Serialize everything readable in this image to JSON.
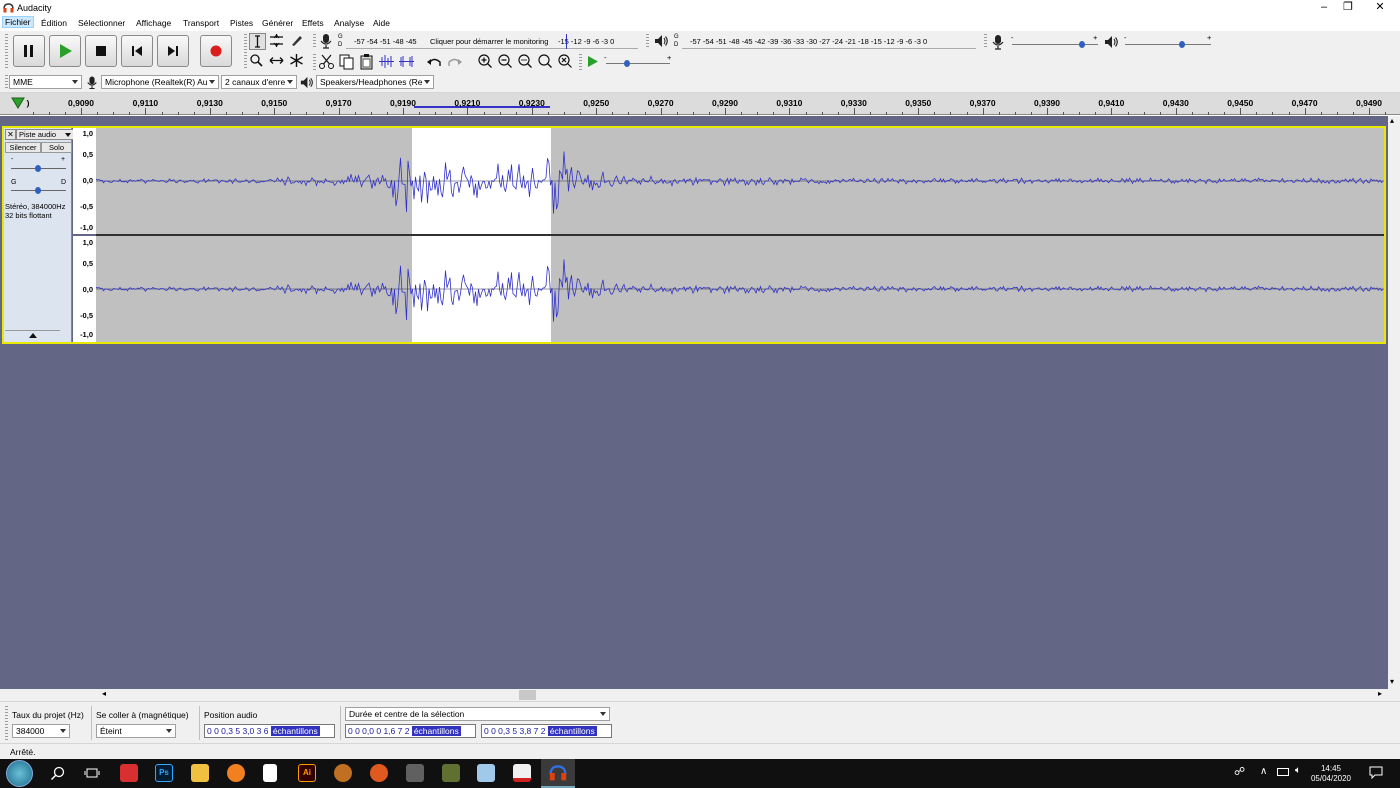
{
  "window": {
    "title": "Audacity"
  },
  "menu": [
    "Fichier",
    "Édition",
    "Sélectionner",
    "Affichage",
    "Transport",
    "Pistes",
    "Générer",
    "Effets",
    "Analyse",
    "Aide"
  ],
  "meters": {
    "record_channel_l": "G",
    "record_channel_r": "D",
    "record_scale": "-57 -54 -51 -48 -45",
    "record_hint": "Cliquer pour démarrer le monitoring",
    "record_scale2": "-15 -12 -9 -6 -3 0",
    "play_scale": "-57 -54 -51 -48 -45 -42 -39 -36 -33 -30 -27 -24 -21 -18 -15 -12 -9 -6 -3 0",
    "play_channel_l": "G",
    "play_channel_r": "D",
    "minus": "-",
    "plus": "+"
  },
  "device": {
    "host": "MME",
    "input": "Microphone (Realtek(R) Au",
    "channels": "2 canaux d'enre",
    "output": "Speakers/Headphones (Re"
  },
  "ruler": {
    "first_partial": ")",
    "labels": [
      "0,9090",
      "0,9110",
      "0,9130",
      "0,9150",
      "0,9170",
      "0,9190",
      "0,9210",
      "0,9230",
      "0,9250",
      "0,9270",
      "0,9290",
      "0,9310",
      "0,9330",
      "0,9350",
      "0,9370",
      "0,9390",
      "0,9410",
      "0,9430",
      "0,9450",
      "0,9470",
      "0,9490"
    ]
  },
  "track": {
    "name": "Piste audio",
    "mute": "Silencer",
    "solo": "Solo",
    "gain_minus": "-",
    "gain_plus": "+",
    "pan_left": "G",
    "pan_right": "D",
    "info_line1": "Stéréo, 384000Hz",
    "info_line2": "32 bits flottant",
    "scale": [
      "1,0",
      "0,5",
      "0,0",
      "-0,5",
      "-1,0"
    ],
    "selection_fraction": {
      "start": 0.245,
      "end": 0.353
    }
  },
  "selection_toolbar": {
    "rate_label": "Taux du projet (Hz)",
    "rate_value": "384000",
    "snap_label": "Se coller à (magnétique)",
    "snap_value": "Éteint",
    "position_label": "Position audio",
    "position_value": "0 0 0,3 5 3,0 3 6",
    "selection_mode": "Durée et centre de la sélection",
    "duration_value": "0 0 0,0 0 1,6 7 2",
    "center_value": "0 0 0,3 5 3,8 7 2",
    "unit": "échantillons"
  },
  "status": {
    "text": "Arrêté."
  },
  "taskbar": {
    "time": "14:45",
    "date": "05/04/2020"
  },
  "colors": {
    "waveform": "#3232c8",
    "background": "#636685",
    "selection": "#ffffff",
    "unselected": "#c0c0c0",
    "focus": "#e8e800"
  }
}
